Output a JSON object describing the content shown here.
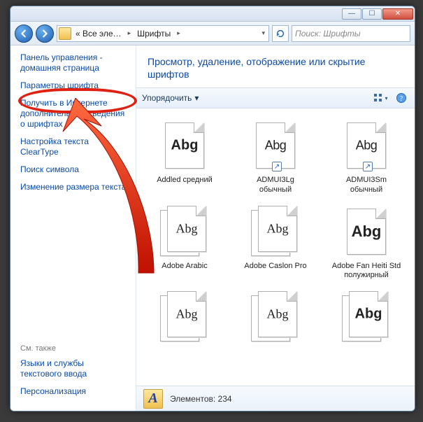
{
  "titlebar": {
    "min": "—",
    "max": "☐",
    "close": "✕"
  },
  "nav": {
    "back_aria": "Назад",
    "fwd_aria": "Вперёд",
    "crumb_root": "« Все эле…",
    "crumb_current": "Шрифты",
    "refresh_aria": "Обновить",
    "search_placeholder": "Поиск: Шрифты"
  },
  "sidebar": {
    "links": [
      "Панель управления - домашняя страница",
      "Параметры шрифта",
      "Получить в Интернете дополнительные сведения о шрифтах",
      "Настройка текста ClearType",
      "Поиск символа",
      "Изменение размера текста"
    ],
    "seealso_label": "См. также",
    "seealso_links": [
      "Языки и службы текстового ввода",
      "Персонализация"
    ]
  },
  "header": {
    "title": "Просмотр, удаление, отображение или скрытие шрифтов"
  },
  "toolbar": {
    "organize": "Упорядочить",
    "chev": "▾",
    "view_aria": "Вид",
    "help_aria": "Справка"
  },
  "fonts": [
    {
      "label": "Addled средний",
      "sample": "Abg",
      "style": "bold",
      "stack": false,
      "shortcut": false
    },
    {
      "label": "ADMUI3Lg обычный",
      "sample": "Abg",
      "style": "cond",
      "stack": false,
      "shortcut": true
    },
    {
      "label": "ADMUI3Sm обычный",
      "sample": "Abg",
      "style": "cond",
      "stack": false,
      "shortcut": true
    },
    {
      "label": "Adobe Arabic",
      "sample": "Abg",
      "style": "",
      "stack": true,
      "shortcut": false
    },
    {
      "label": "Adobe Caslon Pro",
      "sample": "Abg",
      "style": "",
      "stack": true,
      "shortcut": false
    },
    {
      "label": "Adobe Fan Heiti Std полужирный",
      "sample": "Abg",
      "style": "ultra",
      "stack": false,
      "shortcut": false
    },
    {
      "label": "",
      "sample": "Abg",
      "style": "",
      "stack": true,
      "shortcut": false
    },
    {
      "label": "",
      "sample": "Abg",
      "style": "",
      "stack": true,
      "shortcut": false
    },
    {
      "label": "",
      "sample": "Abg",
      "style": "bold",
      "stack": true,
      "shortcut": false
    }
  ],
  "status": {
    "count_label": "Элементов:",
    "count_value": "234"
  }
}
